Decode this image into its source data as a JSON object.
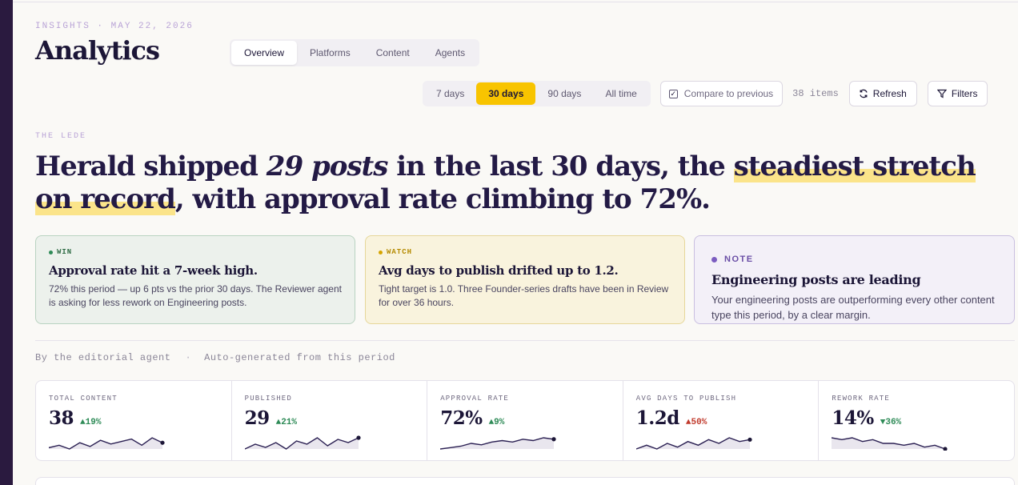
{
  "header": {
    "eyebrow": "INSIGHTS · MAY 22, 2026",
    "title": "Analytics",
    "tabs": [
      {
        "label": "Overview",
        "active": true
      },
      {
        "label": "Platforms",
        "active": false
      },
      {
        "label": "Content",
        "active": false
      },
      {
        "label": "Agents",
        "active": false
      }
    ]
  },
  "toolbar": {
    "ranges": [
      {
        "label": "7 days",
        "active": false
      },
      {
        "label": "30 days",
        "active": true
      },
      {
        "label": "90 days",
        "active": false
      },
      {
        "label": "All time",
        "active": false
      }
    ],
    "compare_label": "Compare to previous",
    "compare_checked": true,
    "items_count": "38 items",
    "refresh_label": "Refresh",
    "filters_label": "Filters"
  },
  "lede": {
    "label": "THE LEDE",
    "part1": "Herald shipped ",
    "emphasis": "29 posts",
    "part2": " in the last 30 days, the ",
    "highlight": "steadiest stretch on record",
    "part3": ", with approval rate climbing to 72%."
  },
  "cards": [
    {
      "tag": "WIN",
      "title": "Approval rate hit a 7-week high.",
      "body": "72% this period — up 6 pts vs the prior 30 days. The Reviewer agent is asking for less rework on Engineering posts."
    },
    {
      "tag": "WATCH",
      "title": "Avg days to publish drifted up to 1.2.",
      "body": "Tight target is 1.0. Three Founder-series drafts have been in Review for over 36 hours."
    },
    {
      "tag": "NOTE",
      "title": "Engineering posts are leading",
      "body": "Your engineering posts are outperforming every other content type this period, by a clear margin."
    }
  ],
  "byline": {
    "author": "By the editorial agent",
    "separator": "·",
    "note": "Auto-generated from this period"
  },
  "kpis": [
    {
      "label": "TOTAL CONTENT",
      "value": "38",
      "delta": "▲19%",
      "trend": "good",
      "spark": [
        2,
        4,
        1,
        6,
        3,
        8,
        5,
        7,
        9,
        4,
        10,
        6
      ]
    },
    {
      "label": "PUBLISHED",
      "value": "29",
      "delta": "▲21%",
      "trend": "good",
      "spark": [
        2,
        5,
        3,
        6,
        2,
        7,
        5,
        9,
        4,
        8,
        6,
        9
      ]
    },
    {
      "label": "APPROVAL RATE",
      "value": "72%",
      "delta": "▲9%",
      "trend": "good",
      "spark": [
        1,
        2,
        3,
        5,
        4,
        6,
        7,
        6,
        8,
        7,
        9,
        8
      ]
    },
    {
      "label": "AVG DAYS TO PUBLISH",
      "value": "1.2d",
      "delta": "▲50%",
      "trend": "bad",
      "spark": [
        2,
        4,
        2,
        5,
        3,
        6,
        4,
        7,
        5,
        8,
        6,
        7
      ]
    },
    {
      "label": "REWORK RATE",
      "value": "14%",
      "delta": "▼36%",
      "trend": "good",
      "spark": [
        9,
        8,
        9,
        7,
        8,
        6,
        6,
        5,
        6,
        4,
        5,
        3
      ]
    }
  ],
  "colors": {
    "accent": "#f8c400",
    "ink": "#1c1637",
    "good": "#2e8b57",
    "bad": "#c0392b",
    "sidebar": "#2a1a3f"
  }
}
